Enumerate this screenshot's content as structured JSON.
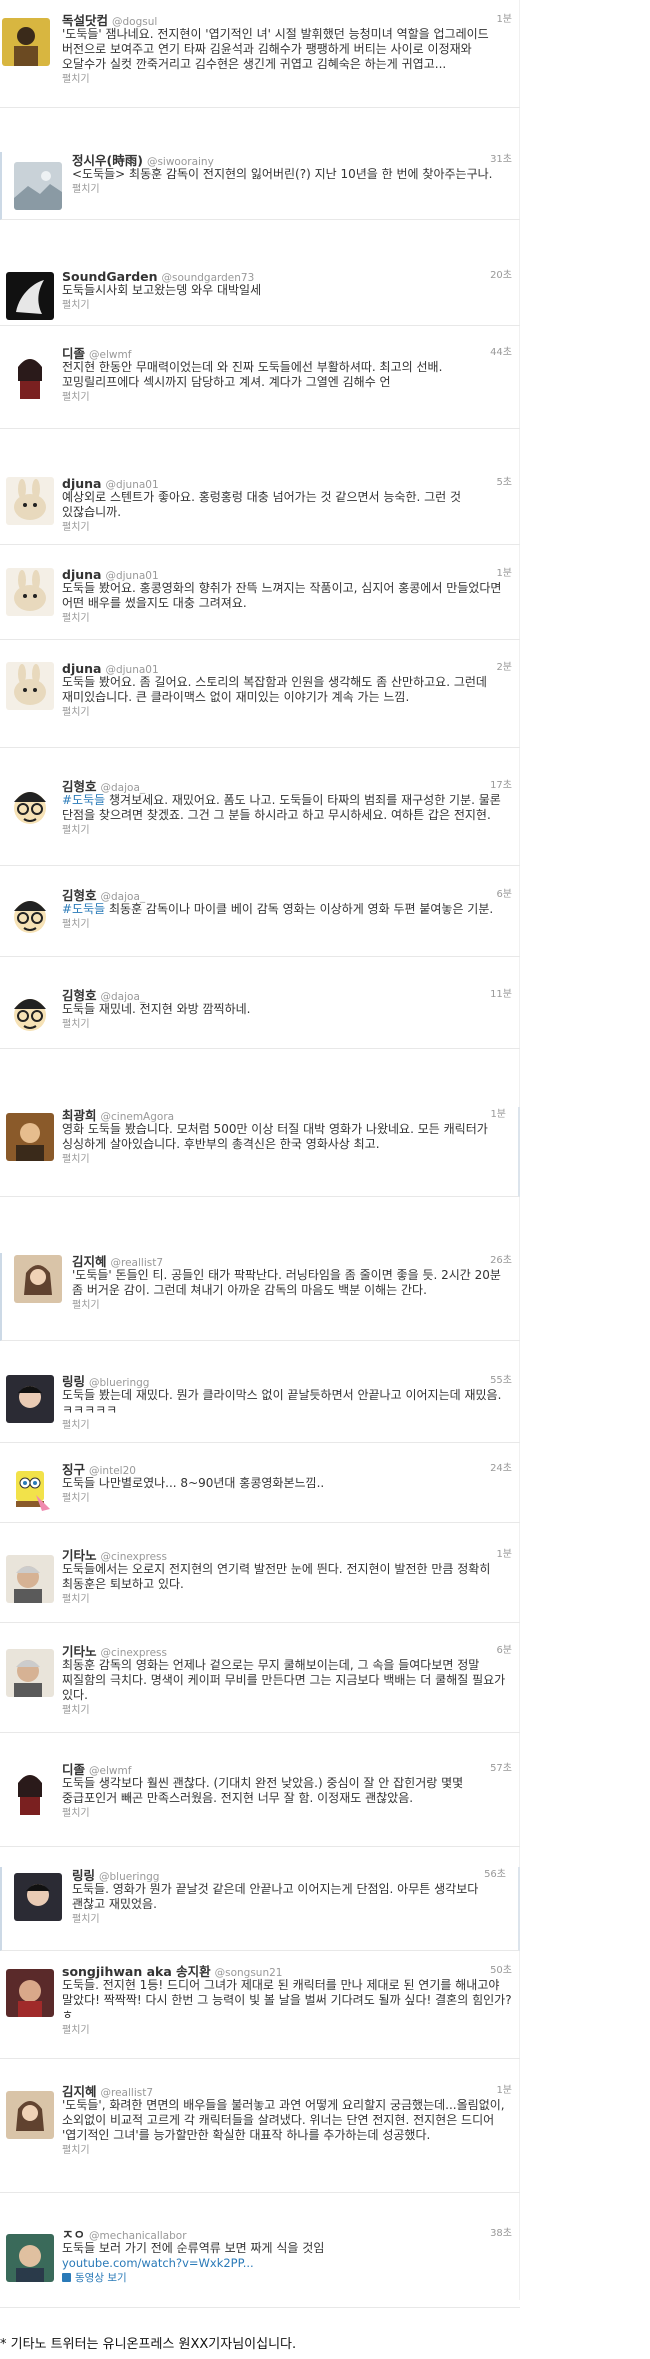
{
  "tweets": [
    {
      "name": "독설닷컴",
      "handle": "@dogsul",
      "time": "1분",
      "text": "'도둑들' 잼나네요. 전지현이 '엽기적인 녀' 시절 발휘했던 능청미녀 역할을 업그레이드 버전으로 보여주고 연기 타짜 김윤석과 김해수가 팽팽하게 버티는 사이로 이정재와 오달수가 실컷 깐죽거리고 김수현은 생긴게 귀엽고 김혜숙은 하는게 귀엽고...",
      "expand": "펼치기"
    },
    {
      "name": "정시우(時雨)",
      "handle": "@siwoorainy",
      "time": "31초",
      "text": "<도둑들> 최동훈 감독이 전지현의 잃어버린(?) 지난 10년을 한 번에 찾아주는구나.",
      "expand": "펼치기"
    },
    {
      "name": "SoundGarden",
      "handle": "@soundgarden73",
      "time": "20초",
      "text": "도둑들시사회 보고왔는뎅 와우 대박일세",
      "expand": "펼치기"
    },
    {
      "name": "디졸",
      "handle": "@elwmf",
      "time": "44초",
      "text": "전지현 한동안 무매력이었는데 와 진짜 도둑들에선 부활하셔따. 최고의 선배. 꼬밍릴리프에다 섹시까지 담당하고 계셔. 계다가 그열엔 김해수 언",
      "expand": "펼치기"
    },
    {
      "name": "djuna",
      "handle": "@djuna01",
      "time": "5초",
      "text": "예상외로 스텐트가 좋아요. 홍렁홍렁 대충 넘어가는 것 같으면서 능숙한. 그런 것 있잖습니까.",
      "expand": "펼치기"
    },
    {
      "name": "djuna",
      "handle": "@djuna01",
      "time": "1분",
      "text": "도둑들 봤어요. 홍콩영화의 향취가 잔뜩 느껴지는 작품이고, 심지어 홍콩에서 만들었다면 어떤 배우를 썼을지도 대충 그려져요.",
      "expand": "펼치기"
    },
    {
      "name": "djuna",
      "handle": "@djuna01",
      "time": "2분",
      "text": "도둑들 봤어요. 좀 길어요. 스토리의 복잡함과 인원을 생각해도 좀 산만하고요. 그런데 재미있습니다. 큰 클라이맥스 없이 재미있는 이야기가 계속 가는 느낌.",
      "expand": "펼치기"
    },
    {
      "name": "김형호",
      "handle": "@dajoa_",
      "time": "17초",
      "text_tag": "#도둑들",
      "text": " 챙겨보세요. 재밌어요. 폼도 나고. 도둑들이 타짜의 범죄를 재구성한 기분. 물론 단점을 찾으려면 찾겠죠. 그건 그 분들 하시라고 하고 무시하세요. 여하튼 갑은 전지현.",
      "expand": "펼치기"
    },
    {
      "name": "김형호",
      "handle": "@dajoa_",
      "time": "6분",
      "text_tag": "#도둑들",
      "text": " 최동훈 감독이나 마이클 베이 감독 영화는 이상하게 영화 두편 붙여놓은 기분.",
      "expand": "펼치기"
    },
    {
      "name": "김형호",
      "handle": "@dajoa_",
      "time": "11분",
      "text": "도둑들 재밌네. 전지현 와방 깜찍하네.",
      "expand": "펼치기"
    },
    {
      "name": "최광희",
      "handle": "@cinemAgora",
      "time": "1분",
      "text": "영화 도둑들 봤습니다. 모처럼 500만 이상 터질 대박 영화가 나왔네요. 모든 캐릭터가 싱싱하게 살아있습니다. 후반부의 총격신은 한국 영화사상 최고.",
      "expand": "펼치기"
    },
    {
      "name": "김지혜",
      "handle": "@reallist7",
      "time": "26초",
      "text": "'도둑들' 돈들인 티. 공들인 태가 팍팍난다. 러닝타임을 좀 줄이면 좋을 듯. 2시간 20분 좀 버거운 감이. 그런데 쳐내기 아까운 감독의 마음도 백분 이해는 간다.",
      "expand": "펼치기"
    },
    {
      "name": "링링",
      "handle": "@blueringg",
      "time": "55초",
      "text": "도둑들 봤는데 재밌다. 뭔가 클라이막스 없이 끝날듯하면서 안끝나고 이어지는데 재밌음. ㅋㅋㅋㅋㅋ",
      "expand": "펼치기"
    },
    {
      "name": "징구",
      "handle": "@intel20",
      "time": "24초",
      "text": "도둑들 나만별로였나... 8~90년대 홍콩영화본느낌..",
      "expand": "펼치기"
    },
    {
      "name": "기타노",
      "handle": "@cinexpress",
      "time": "1분",
      "text": "도둑들에서는 오로지 전지현의 연기력 발전만 눈에 띈다. 전지현이 발전한 만큼 정확히 최동훈은 퇴보하고 있다.",
      "expand": "펼치기"
    },
    {
      "name": "기타노",
      "handle": "@cinexpress",
      "time": "6분",
      "text": "최동훈 감독의 영화는 언제나 겉으로는 무지 쿨해보이는데, 그 속을 들여다보면 정말 찌질함의 극치다. 명색이 케이퍼 무비를 만든다면 그는 지금보다 백배는 더 쿨해질 필요가 있다.",
      "expand": "펼치기"
    },
    {
      "name": "디졸",
      "handle": "@elwmf",
      "time": "57초",
      "text": "도둑들 생각보다 훨씬 괜찮다. (기대치 완전 낮았음.) 중심이 잘 안 잡힌거랑 몇몇 중급포인거 빼곤 만족스러웠음. 전지현 너무 잘 함. 이정재도 괜찮았음.",
      "expand": "펼치기"
    },
    {
      "name": "링링",
      "handle": "@blueringg",
      "time": "56초",
      "text": "도둑들. 영화가 뭔가 끝날것 같은데 안끝나고 이어지는게 단점임. 아무튼 생각보다 괜찮고 재밌었음.",
      "expand": "펼치기"
    },
    {
      "name": "songjihwan aka 송지환",
      "handle": "@songsun21",
      "time": "50초",
      "text": "도둑들. 전지현 1등! 드디어 그녀가 제대로 된 캐릭터를 만나 제대로 된 연기를 해내고야 말았다! 짝짝짝! 다시 한번 그 능력이 빛 볼 날을 벌써 기다려도 될까 싶다! 결혼의 힘인가? ㅎ",
      "expand": "펼치기"
    },
    {
      "name": "김지혜",
      "handle": "@reallist7",
      "time": "1분",
      "text": "'도둑들', 화려한 면면의 배우들을 불러놓고 과연 어떻게 요리할지 궁금했는데...올림없이, 소외없이 비교적 고르게 각 캐릭터들을 살려냈다. 위너는 단연 전지현. 전지현은 드디어 '엽기적인 그녀'를 능가할만한 확실한 대표작 하나를 추가하는데 성공했다.",
      "expand": "펼치기"
    },
    {
      "name": "ㅈㅇ",
      "handle": "@mechanicallabor",
      "time": "38초",
      "text": "도둑들 보러 가기 전에 순류역류 보면 짜게 식을 것임",
      "link": "youtube.com/watch?v=Wxk2PP...",
      "video": "동영상 보기"
    }
  ],
  "footer": "* 기타노 트위터는 유니온프레스 원XX기자님이십니다.",
  "colors": {
    "link": "#2a7ab8",
    "meta": "#999999",
    "text": "#333333"
  },
  "icons": [
    "avatar-photo-icon",
    "cartoon-avatar-icon",
    "play-icon"
  ]
}
